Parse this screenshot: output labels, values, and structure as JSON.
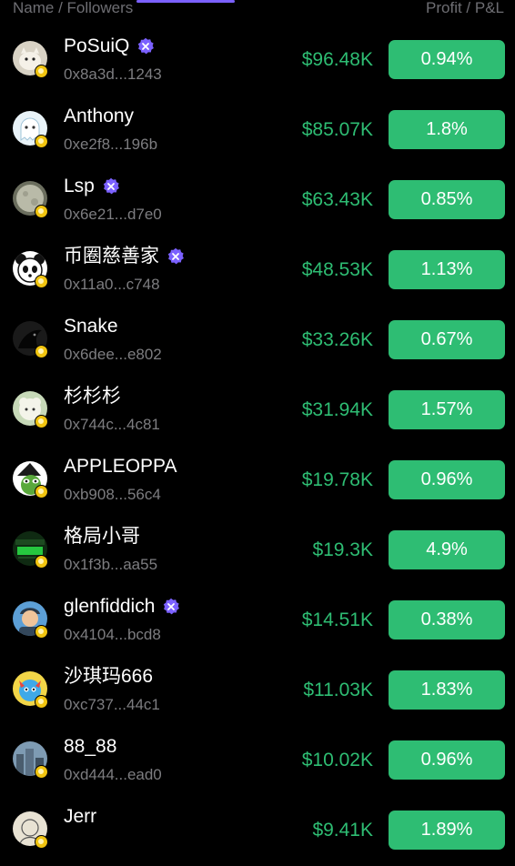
{
  "header": {
    "name_label": "Name / Followers",
    "profit_label": "Profit / P&L"
  },
  "colors": {
    "background": "#000000",
    "profit_green": "#2ebd73",
    "pnl_button": "#2ebd73",
    "verified_purple": "#7b61ff",
    "muted_text": "#7d7d80"
  },
  "traders": [
    {
      "name": "PoSuiQ",
      "address": "0x8a3d...1243",
      "profit": "$96.48K",
      "pnl": "0.94%",
      "verified": true,
      "avatar_icon": "white-cat-avatar-icon"
    },
    {
      "name": "Anthony",
      "address": "0xe2f8...196b",
      "profit": "$85.07K",
      "pnl": "1.8%",
      "verified": false,
      "avatar_icon": "white-ghost-avatar-icon"
    },
    {
      "name": "Lsp",
      "address": "0x6e21...d7e0",
      "profit": "$63.43K",
      "pnl": "0.85%",
      "verified": true,
      "avatar_icon": "grey-moon-avatar-icon"
    },
    {
      "name": "币圈慈善家",
      "address": "0x11a0...c748",
      "profit": "$48.53K",
      "pnl": "1.13%",
      "verified": true,
      "avatar_icon": "panda-avatar-icon"
    },
    {
      "name": "Snake",
      "address": "0x6dee...e802",
      "profit": "$33.26K",
      "pnl": "0.67%",
      "verified": false,
      "avatar_icon": "black-crow-avatar-icon"
    },
    {
      "name": "杉杉杉",
      "address": "0x744c...4c81",
      "profit": "$31.94K",
      "pnl": "1.57%",
      "verified": false,
      "avatar_icon": "sheep-avatar-icon"
    },
    {
      "name": "APPLEOPPA",
      "address": "0xb908...56c4",
      "profit": "$19.78K",
      "pnl": "0.96%",
      "verified": false,
      "avatar_icon": "pepe-witch-avatar-icon"
    },
    {
      "name": "格局小哥",
      "address": "0x1f3b...aa55",
      "profit": "$19.3K",
      "pnl": "4.9%",
      "verified": false,
      "avatar_icon": "green-pnl-card-avatar-icon"
    },
    {
      "name": "glenfiddich",
      "address": "0x4104...bcd8",
      "profit": "$14.51K",
      "pnl": "0.38%",
      "verified": true,
      "avatar_icon": "cartoon-man-avatar-icon"
    },
    {
      "name": "沙琪玛666",
      "address": "0xc737...44c1",
      "profit": "$11.03K",
      "pnl": "1.83%",
      "verified": false,
      "avatar_icon": "colorful-creature-avatar-icon"
    },
    {
      "name": "88_88",
      "address": "0xd444...ead0",
      "profit": "$10.02K",
      "pnl": "0.96%",
      "verified": false,
      "avatar_icon": "city-photo-avatar-icon"
    },
    {
      "name": "Jerr",
      "address": "",
      "profit": "$9.41K",
      "pnl": "1.89%",
      "verified": false,
      "avatar_icon": "sketch-avatar-icon"
    }
  ]
}
